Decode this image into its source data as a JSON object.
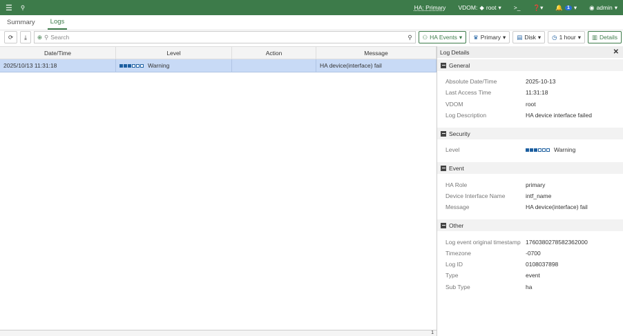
{
  "topbar": {
    "ha": "HA: Primary",
    "vdom": "VDOM:",
    "vdom_value": "root",
    "notif_count": "1",
    "user": "admin"
  },
  "tabs": [
    "Summary",
    "Logs"
  ],
  "toolbar": {
    "search_placeholder": "Search",
    "ha_events": "HA Events",
    "primary": "Primary",
    "disk": "Disk",
    "time": "1 hour",
    "details": "Details"
  },
  "table": {
    "headers": [
      "Date/Time",
      "Level",
      "Action",
      "Message"
    ],
    "rows": [
      {
        "datetime": "2025/10/13 11:31:18",
        "level": "Warning",
        "level_bars": 3,
        "action": "",
        "message": "HA device(interface) fail"
      }
    ]
  },
  "footer": {
    "page": "1"
  },
  "details": {
    "title": "Log Details",
    "sections": [
      {
        "name": "General",
        "rows": [
          [
            "Absolute Date/Time",
            "2025-10-13"
          ],
          [
            "Last Access Time",
            "11:31:18"
          ],
          [
            "VDOM",
            "root"
          ],
          [
            "Log Description",
            "HA device interface failed"
          ]
        ]
      },
      {
        "name": "Security",
        "level_label": "Level",
        "level_value": "Warning"
      },
      {
        "name": "Event",
        "rows": [
          [
            "HA Role",
            "primary"
          ],
          [
            "Device Interface Name",
            "intf_name"
          ],
          [
            "Message",
            "HA device(interface) fail"
          ]
        ]
      },
      {
        "name": "Other",
        "rows": [
          [
            "Log event original timestamp",
            "1760380278582362000"
          ],
          [
            "Timezone",
            "-0700"
          ],
          [
            "Log ID",
            "0108037898"
          ],
          [
            "Type",
            "event"
          ],
          [
            "Sub Type",
            "ha"
          ]
        ]
      }
    ]
  },
  "colors": {
    "brand": "#3d7b4a",
    "selected_row": "#c8daf6",
    "level_bar": "#1d5fa0"
  }
}
